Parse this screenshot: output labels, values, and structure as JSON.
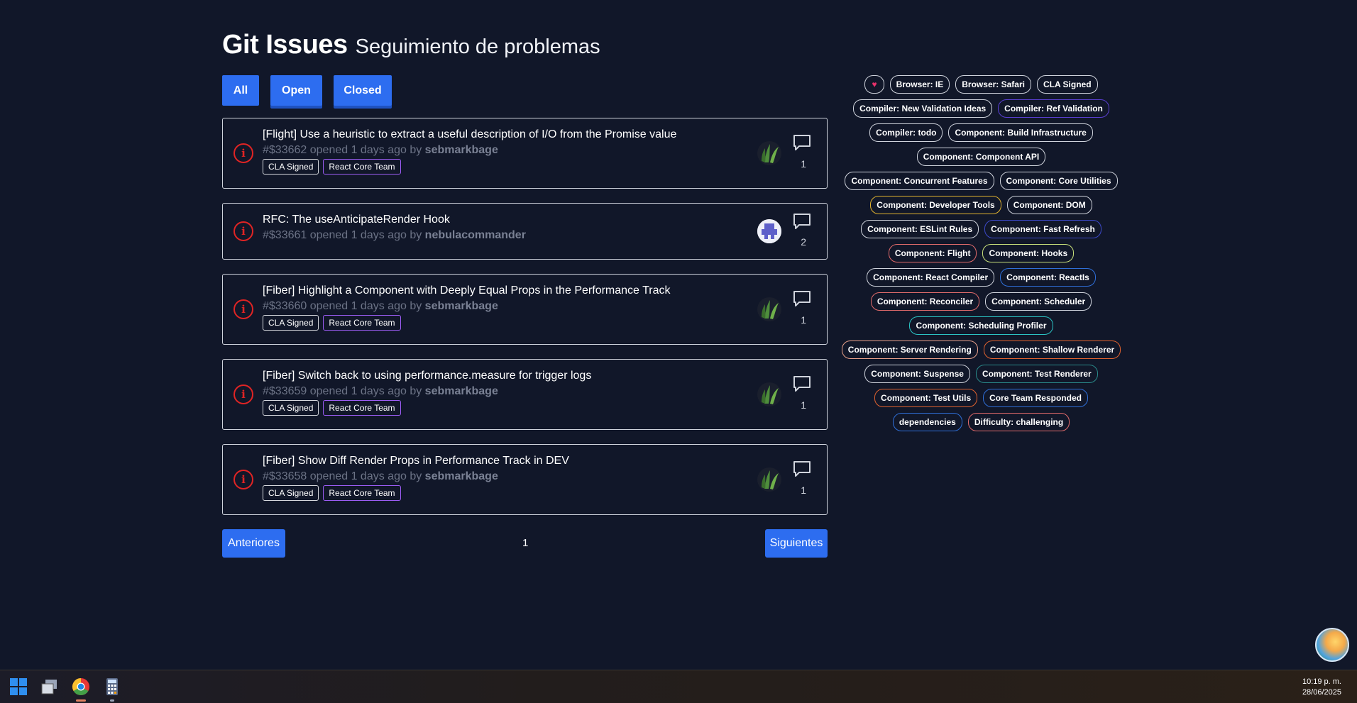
{
  "header": {
    "title": "Git Issues",
    "subtitle": "Seguimiento de problemas"
  },
  "filters": {
    "all": "All",
    "open": "Open",
    "closed": "Closed"
  },
  "issues": [
    {
      "title": "[Flight] Use a heuristic to extract a useful description of I/O from the Promise value",
      "number": "#$33662",
      "opened": "opened 1 days ago by",
      "author": "sebmarkbage",
      "labels": [
        "CLA Signed",
        "React Core Team"
      ],
      "comments": "1"
    },
    {
      "title": "RFC: The useAnticipateRender Hook",
      "number": "#$33661",
      "opened": "opened 1 days ago by",
      "author": "nebulacommander",
      "labels": [],
      "comments": "2"
    },
    {
      "title": "[Fiber] Highlight a Component with Deeply Equal Props in the Performance Track",
      "number": "#$33660",
      "opened": "opened 1 days ago by",
      "author": "sebmarkbage",
      "labels": [
        "CLA Signed",
        "React Core Team"
      ],
      "comments": "1"
    },
    {
      "title": "[Fiber] Switch back to using performance.measure for trigger logs",
      "number": "#$33659",
      "opened": "opened 1 days ago by",
      "author": "sebmarkbage",
      "labels": [
        "CLA Signed",
        "React Core Team"
      ],
      "comments": "1"
    },
    {
      "title": "[Fiber] Show Diff Render Props in Performance Track in DEV",
      "number": "#$33658",
      "opened": "opened 1 days ago by",
      "author": "sebmarkbage",
      "labels": [
        "CLA Signed",
        "React Core Team"
      ],
      "comments": "1"
    }
  ],
  "pagination": {
    "prev": "Anteriores",
    "page": "1",
    "next": "Siguientes"
  },
  "tags": [
    {
      "name": "♥",
      "color": "#cfd3dc"
    },
    {
      "name": "Browser: IE",
      "color": "#cfd3dc"
    },
    {
      "name": "Browser: Safari",
      "color": "#cfd3dc"
    },
    {
      "name": "CLA Signed",
      "color": "#cfd3dc"
    },
    {
      "name": "Compiler: New Validation Ideas",
      "color": "#cfd3dc"
    },
    {
      "name": "Compiler: Ref Validation",
      "color": "#5a3fd1"
    },
    {
      "name": "Compiler: todo",
      "color": "#cfd3dc"
    },
    {
      "name": "Component: Build Infrastructure",
      "color": "#cfd3dc"
    },
    {
      "name": "Component: Component API",
      "color": "#cfd3dc"
    },
    {
      "name": "Component: Concurrent Features",
      "color": "#cfd3dc"
    },
    {
      "name": "Component: Core Utilities",
      "color": "#cfd3dc"
    },
    {
      "name": "Component: Developer Tools",
      "color": "#e0b22f"
    },
    {
      "name": "Component: DOM",
      "color": "#cfd3dc"
    },
    {
      "name": "Component: ESLint Rules",
      "color": "#cfd3dc"
    },
    {
      "name": "Component: Fast Refresh",
      "color": "#3d49c9"
    },
    {
      "name": "Component: Flight",
      "color": "#e26b6b"
    },
    {
      "name": "Component: Hooks",
      "color": "#c8e07a"
    },
    {
      "name": "Component: React Compiler",
      "color": "#cfd3dc"
    },
    {
      "name": "Component: ReactIs",
      "color": "#2f6fd8"
    },
    {
      "name": "Component: Reconciler",
      "color": "#e26b6b"
    },
    {
      "name": "Component: Scheduler",
      "color": "#cfd3dc"
    },
    {
      "name": "Component: Scheduling Profiler",
      "color": "#2bc3c3"
    },
    {
      "name": "Component: Server Rendering",
      "color": "#e8a08a"
    },
    {
      "name": "Component: Shallow Renderer",
      "color": "#e0622f"
    },
    {
      "name": "Component: Suspense",
      "color": "#cfd3dc"
    },
    {
      "name": "Component: Test Renderer",
      "color": "#2a8a8a"
    },
    {
      "name": "Component: Test Utils",
      "color": "#e0622f"
    },
    {
      "name": "Core Team Responded",
      "color": "#2f6fd8"
    },
    {
      "name": "dependencies",
      "color": "#2f6fd8"
    },
    {
      "name": "Difficulty: challenging",
      "color": "#e26b6b"
    }
  ],
  "clock": {
    "time": "10:19 p. m.",
    "date": "28/06/2025"
  },
  "colors": {
    "background": "#111729",
    "accent": "#2d6df0",
    "issue_open": "#e02424"
  }
}
